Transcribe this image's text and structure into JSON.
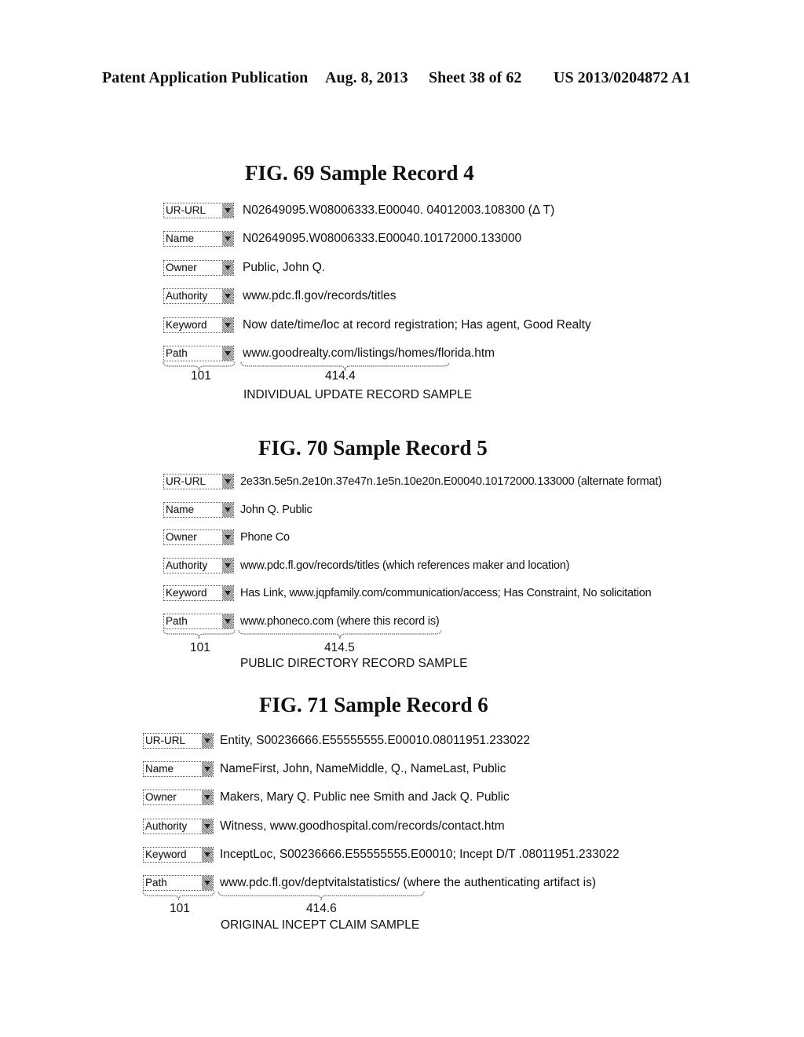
{
  "header": {
    "publication": "Patent Application Publication",
    "date": "Aug. 8, 2013",
    "sheet": "Sheet 38 of 62",
    "number": "US 2013/0204872 A1"
  },
  "figures": [
    {
      "title": "FIG. 69 Sample Record 4",
      "fields": [
        {
          "label": "UR-URL",
          "value": "N02649095.W08006333.E00040. 04012003.108300 (Δ T)"
        },
        {
          "label": "Name",
          "value": "N02649095.W08006333.E00040.10172000.133000"
        },
        {
          "label": "Owner",
          "value": "Public, John Q."
        },
        {
          "label": "Authority",
          "value": "www.pdc.fl.gov/records/titles"
        },
        {
          "label": "Keyword",
          "value": "Now date/time/loc at record registration; Has agent, Good Realty"
        },
        {
          "label": "Path",
          "value": "www.goodrealty.com/listings/homes/florida.htm"
        }
      ],
      "field_ref": "101",
      "value_ref": "414.4",
      "caption": "INDIVIDUAL UPDATE RECORD SAMPLE"
    },
    {
      "title": "FIG. 70 Sample Record 5",
      "fields": [
        {
          "label": "UR-URL",
          "value": "2e33n.5e5n.2e10n.37e47n.1e5n.10e20n.E00040.10172000.133000 (alternate format)"
        },
        {
          "label": "Name",
          "value": "John Q. Public"
        },
        {
          "label": "Owner",
          "value": "Phone Co"
        },
        {
          "label": "Authority",
          "value": "www.pdc.fl.gov/records/titles (which references maker and location)"
        },
        {
          "label": "Keyword",
          "value": "Has Link, www.jqpfamily.com/communication/access; Has Constraint, No solicitation"
        },
        {
          "label": "Path",
          "value": "www.phoneco.com (where this record is)"
        }
      ],
      "field_ref": "101",
      "value_ref": "414.5",
      "caption": "PUBLIC DIRECTORY RECORD SAMPLE"
    },
    {
      "title": "FIG. 71 Sample Record 6",
      "fields": [
        {
          "label": "UR-URL",
          "value": "Entity, S00236666.E55555555.E00010.08011951.233022"
        },
        {
          "label": "Name",
          "value": "NameFirst, John, NameMiddle, Q., NameLast, Public"
        },
        {
          "label": "Owner",
          "value": "Makers, Mary Q. Public nee Smith and Jack Q. Public"
        },
        {
          "label": "Authority",
          "value": "Witness, www.goodhospital.com/records/contact.htm"
        },
        {
          "label": "Keyword",
          "value": "InceptLoc, S00236666.E55555555.E00010; Incept D/T .08011951.233022"
        },
        {
          "label": "Path",
          "value": "www.pdc.fl.gov/deptvitalstatistics/ (where the authenticating artifact is)"
        }
      ],
      "field_ref": "101",
      "value_ref": "414.6",
      "caption": "ORIGINAL INCEPT CLAIM SAMPLE"
    }
  ]
}
